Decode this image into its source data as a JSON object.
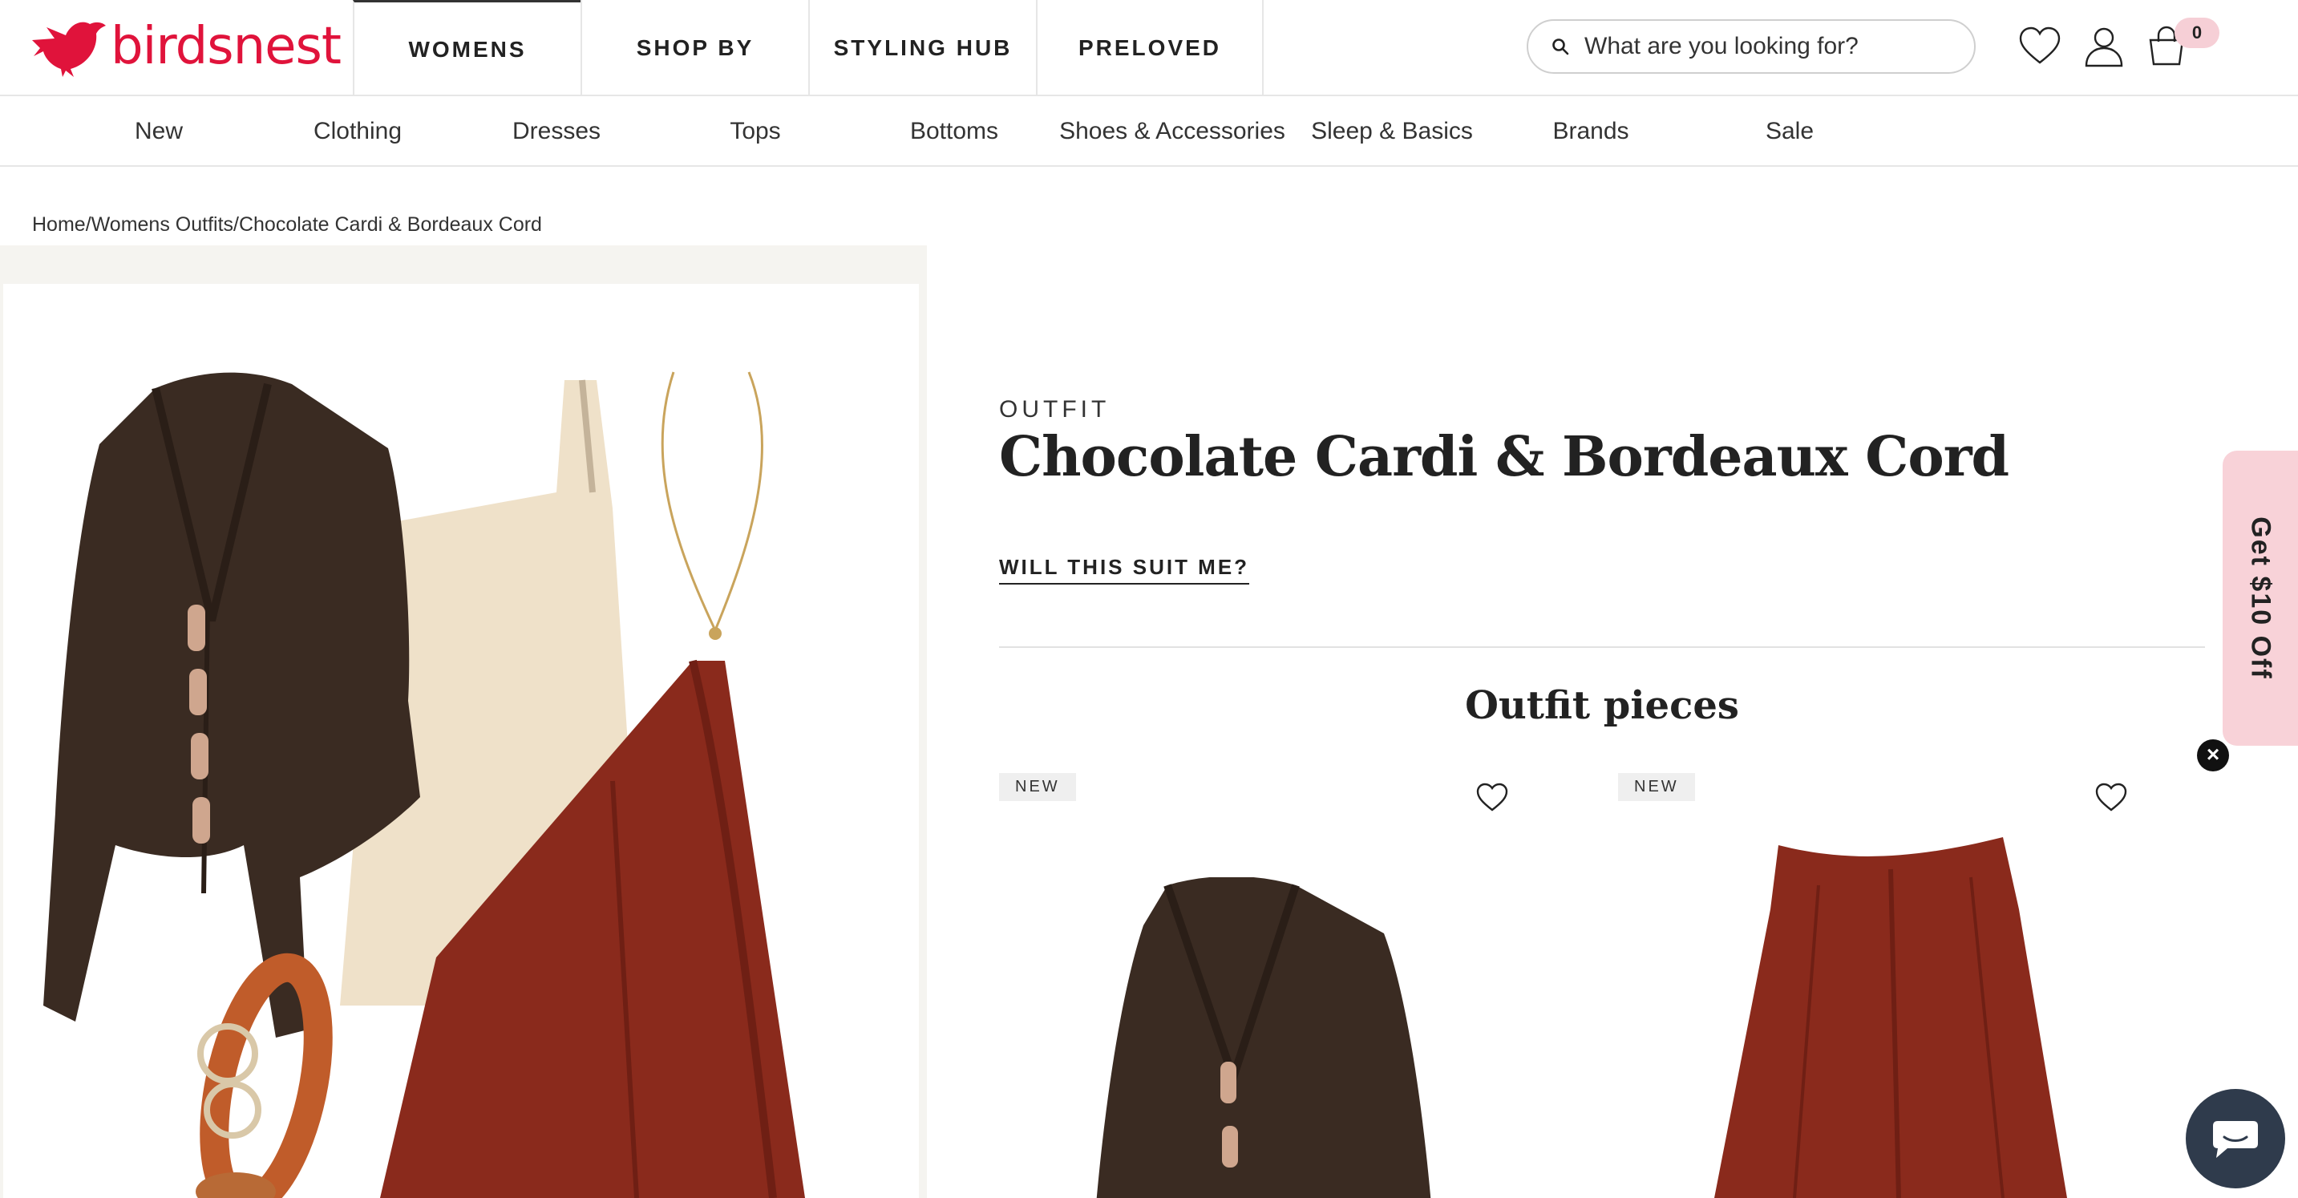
{
  "brand": {
    "name": "birdsnest",
    "color": "#e0133b"
  },
  "main_nav": [
    {
      "label": "WOMENS",
      "active": true
    },
    {
      "label": "SHOP BY",
      "active": false
    },
    {
      "label": "STYLING HUB",
      "active": false
    },
    {
      "label": "PRELOVED",
      "active": false
    }
  ],
  "search": {
    "placeholder": "What are you looking for?",
    "icon": "search-icon"
  },
  "header_icons": [
    "heart-icon",
    "account-icon",
    "bag-icon"
  ],
  "cart": {
    "count": "0"
  },
  "sub_nav": [
    "New",
    "Clothing",
    "Dresses",
    "Tops",
    "Bottoms",
    "Shoes & Accessories",
    "Sleep & Basics",
    "Brands",
    "Sale"
  ],
  "breadcrumb": {
    "home": "Home",
    "sep": "/",
    "category": "Womens Outfits",
    "current": "Chocolate Cardi & Bordeaux Cord"
  },
  "product": {
    "eyebrow": "OUTFIT",
    "title": "Chocolate Cardi & Bordeaux Cord",
    "suit_link": "WILL THIS SUIT ME?"
  },
  "pieces": {
    "title": "Outfit pieces",
    "items": [
      {
        "badge": "NEW",
        "image": "brown-cardigan",
        "favorite": false
      },
      {
        "badge": "NEW",
        "image": "red-cord-skirt",
        "favorite": false
      }
    ]
  },
  "promo": {
    "label": "Get $10 Off",
    "close": "×"
  },
  "colors": {
    "accent": "#e0133b",
    "promo_bg": "#f8d2d8",
    "chat_bg": "#2f3b4c",
    "cardigan": "#3a2b22",
    "skirt": "#8a2a1c"
  }
}
